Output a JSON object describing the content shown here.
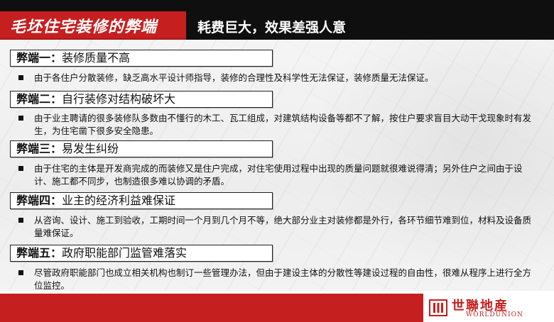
{
  "header": {
    "title": "毛坯住宅装修的弊端",
    "subtitle": "耗费巨大，效果差强人意"
  },
  "sections": [
    {
      "label": "弊端一：",
      "heading": "装修质量不高",
      "bullet": "由于各住户分散装修，缺乏高水平设计师指导，装修的合理性及科学性无法保证，装修质量无法保证。"
    },
    {
      "label": "弊端二：",
      "heading": "自行装修对结构破坏大",
      "bullet": "由于业主聘请的很多装修队多数由不懂行的木工、瓦工组成，对建筑结构设备等都不了解，按住户要求盲目大动干戈现象时有发生，为住宅凿下很多安全隐患。"
    },
    {
      "label": "弊端三：",
      "heading": "易发生纠纷",
      "bullet": "由于住宅的主体是开发商完成的而装修又是住户完成，对住宅使用过程中出现的质量问题就很难说得清；另外住户之间由于设计、施工都不同步，也制造很多难以协调的矛盾。"
    },
    {
      "label": "弊端四：",
      "heading": "业主的经济利益难保证",
      "bullet": "从咨询、设计、施工到验收，工期时间一个月到几个月不等，绝大部分业主对装修都是外行，各环节细节难到位，材料及设备质量难保证。"
    },
    {
      "label": "弊端五：",
      "heading": "政府职能部门监管难落实",
      "bullet": "尽管政府职能部门也成立相关机构也制订一些管理办法，但由于建设主体的分散性等建设过程的自由性，很难从程序上进行全方位监控。"
    }
  ],
  "logo": {
    "cn": "世聯地産",
    "en": "WORLDUNION"
  },
  "colors": {
    "accent": "#c61f1f",
    "header_bg": "#0f0f0f"
  }
}
